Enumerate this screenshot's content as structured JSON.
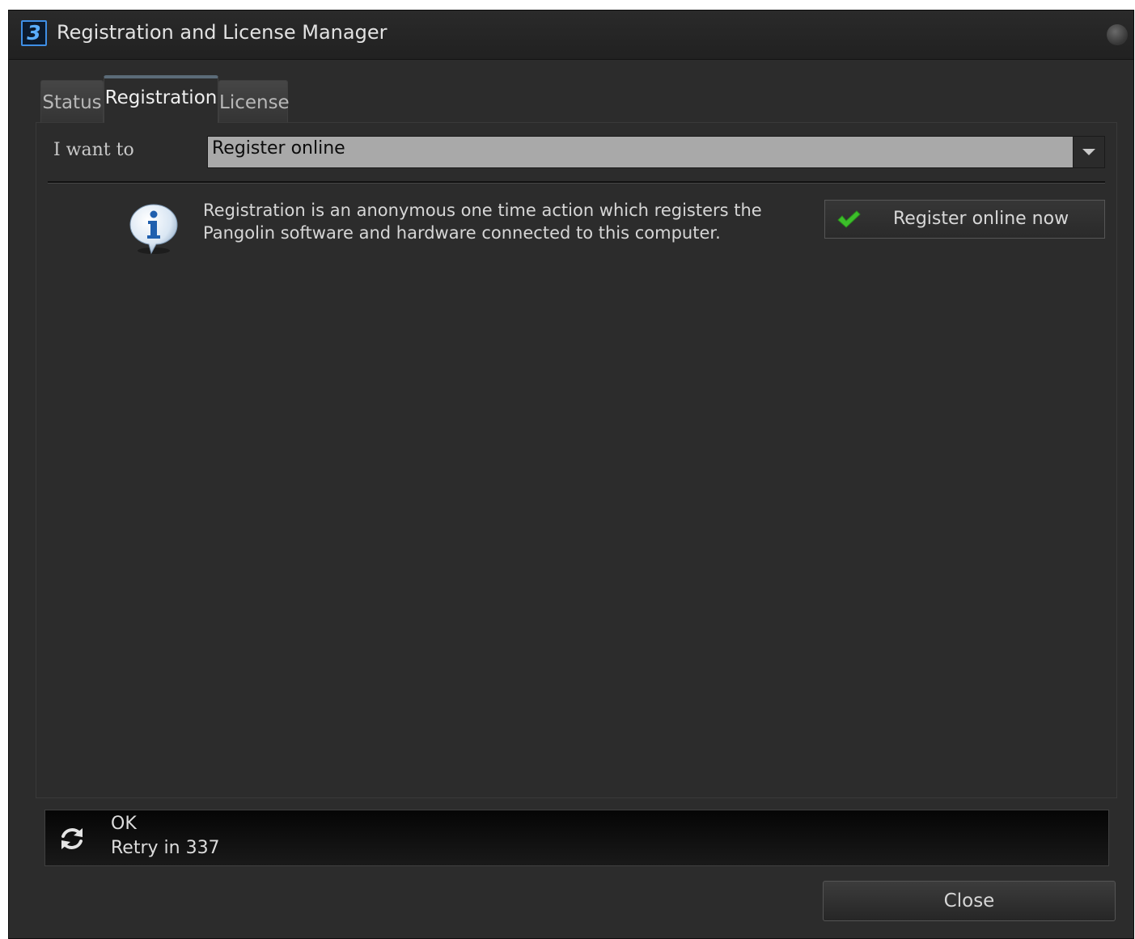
{
  "window": {
    "title": "Registration and License Manager",
    "app_icon_glyph": "3"
  },
  "tabs": [
    {
      "label": "Status",
      "active": false
    },
    {
      "label": "Registration",
      "active": true
    },
    {
      "label": "License",
      "active": false
    }
  ],
  "registration": {
    "want_label": "I want to",
    "action_select": {
      "value": "Register online"
    },
    "info_text": "Registration is an anonymous one time action which registers the Pangolin software and hardware connected to this computer.",
    "register_button_label": "Register online now"
  },
  "status": {
    "state": "OK",
    "retry_text": "Retry in 337"
  },
  "footer": {
    "close_label": "Close"
  },
  "icons": [
    "app-logo-icon",
    "window-ball-icon",
    "info-icon",
    "checkmark-icon",
    "refresh-icon",
    "dropdown-arrow-icon"
  ],
  "colors": {
    "window_bg": "#2c2c2c",
    "select_bg": "#a9a9a9",
    "check_green": "#3cbf2a",
    "info_blue": "#1f5fae"
  }
}
